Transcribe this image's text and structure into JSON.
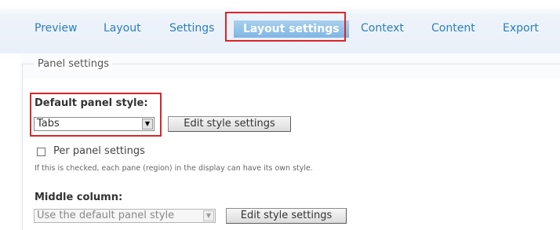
{
  "tabs": [
    {
      "label": "Preview",
      "active": false
    },
    {
      "label": "Layout",
      "active": false
    },
    {
      "label": "Settings",
      "active": false
    },
    {
      "label": "Layout settings",
      "active": true
    },
    {
      "label": "Context",
      "active": false
    },
    {
      "label": "Content",
      "active": false
    },
    {
      "label": "Export",
      "active": false
    }
  ],
  "panel_settings": {
    "legend": "Panel settings",
    "default_style": {
      "label": "Default panel style:",
      "selected": "Tabs",
      "button_label": "Edit style settings"
    },
    "per_panel": {
      "label": "Per panel settings",
      "checked": false,
      "description": "If this is checked, each pane (region) in the display can have its own style."
    },
    "middle_column": {
      "label": "Middle column:",
      "selected": "Use the default panel style",
      "disabled": true,
      "button_label": "Edit style settings"
    }
  },
  "colors": {
    "tab_text": "#2a7fbf",
    "active_tab_bg": "#8ec0e8",
    "highlight_border": "#d9262a"
  }
}
